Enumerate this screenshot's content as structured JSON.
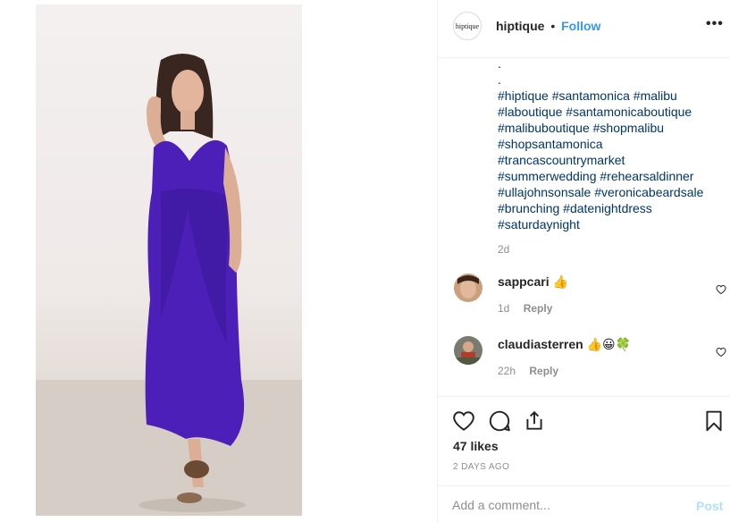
{
  "post": {
    "image_alt": "Woman in a purple ruffled maxi dress"
  },
  "header": {
    "avatar_text": "hiptique",
    "username": "hiptique",
    "separator": "•",
    "follow_label": "Follow",
    "more_icon": "more-horizontal-icon",
    "more_glyph": "•••"
  },
  "caption": {
    "dots": [
      ".",
      "."
    ],
    "hashtags": [
      "#hiptique",
      "#santamonica",
      "#malibu",
      "#laboutique",
      "#santamonicaboutique",
      "#malibuboutique",
      "#shopmalibu",
      "#shopsantamonica",
      "#trancascountrymarket",
      "#summerwedding",
      "#rehearsaldinner",
      "#ullajohnsonsale",
      "#veronicabeardsale",
      "#brunching",
      "#datenightdress",
      "#saturdaynight"
    ],
    "time": "2d"
  },
  "comments": [
    {
      "username": "sappcari",
      "emoji": "👍",
      "time": "1d",
      "reply_label": "Reply"
    },
    {
      "username": "claudiasterren",
      "emoji": "👍😀🍀",
      "time": "22h",
      "reply_label": "Reply"
    }
  ],
  "actions": {
    "icons": [
      "heart-icon",
      "comment-icon",
      "share-icon",
      "bookmark-icon"
    ],
    "likes": "47 likes",
    "date": "2 DAYS AGO"
  },
  "add_comment": {
    "placeholder": "Add a comment...",
    "post_label": "Post"
  },
  "colors": {
    "link": "#003569",
    "follow": "#3897f0",
    "muted": "#8e8e8e",
    "dress": "#4b1fb8",
    "post_disabled": "#b2dffc"
  }
}
